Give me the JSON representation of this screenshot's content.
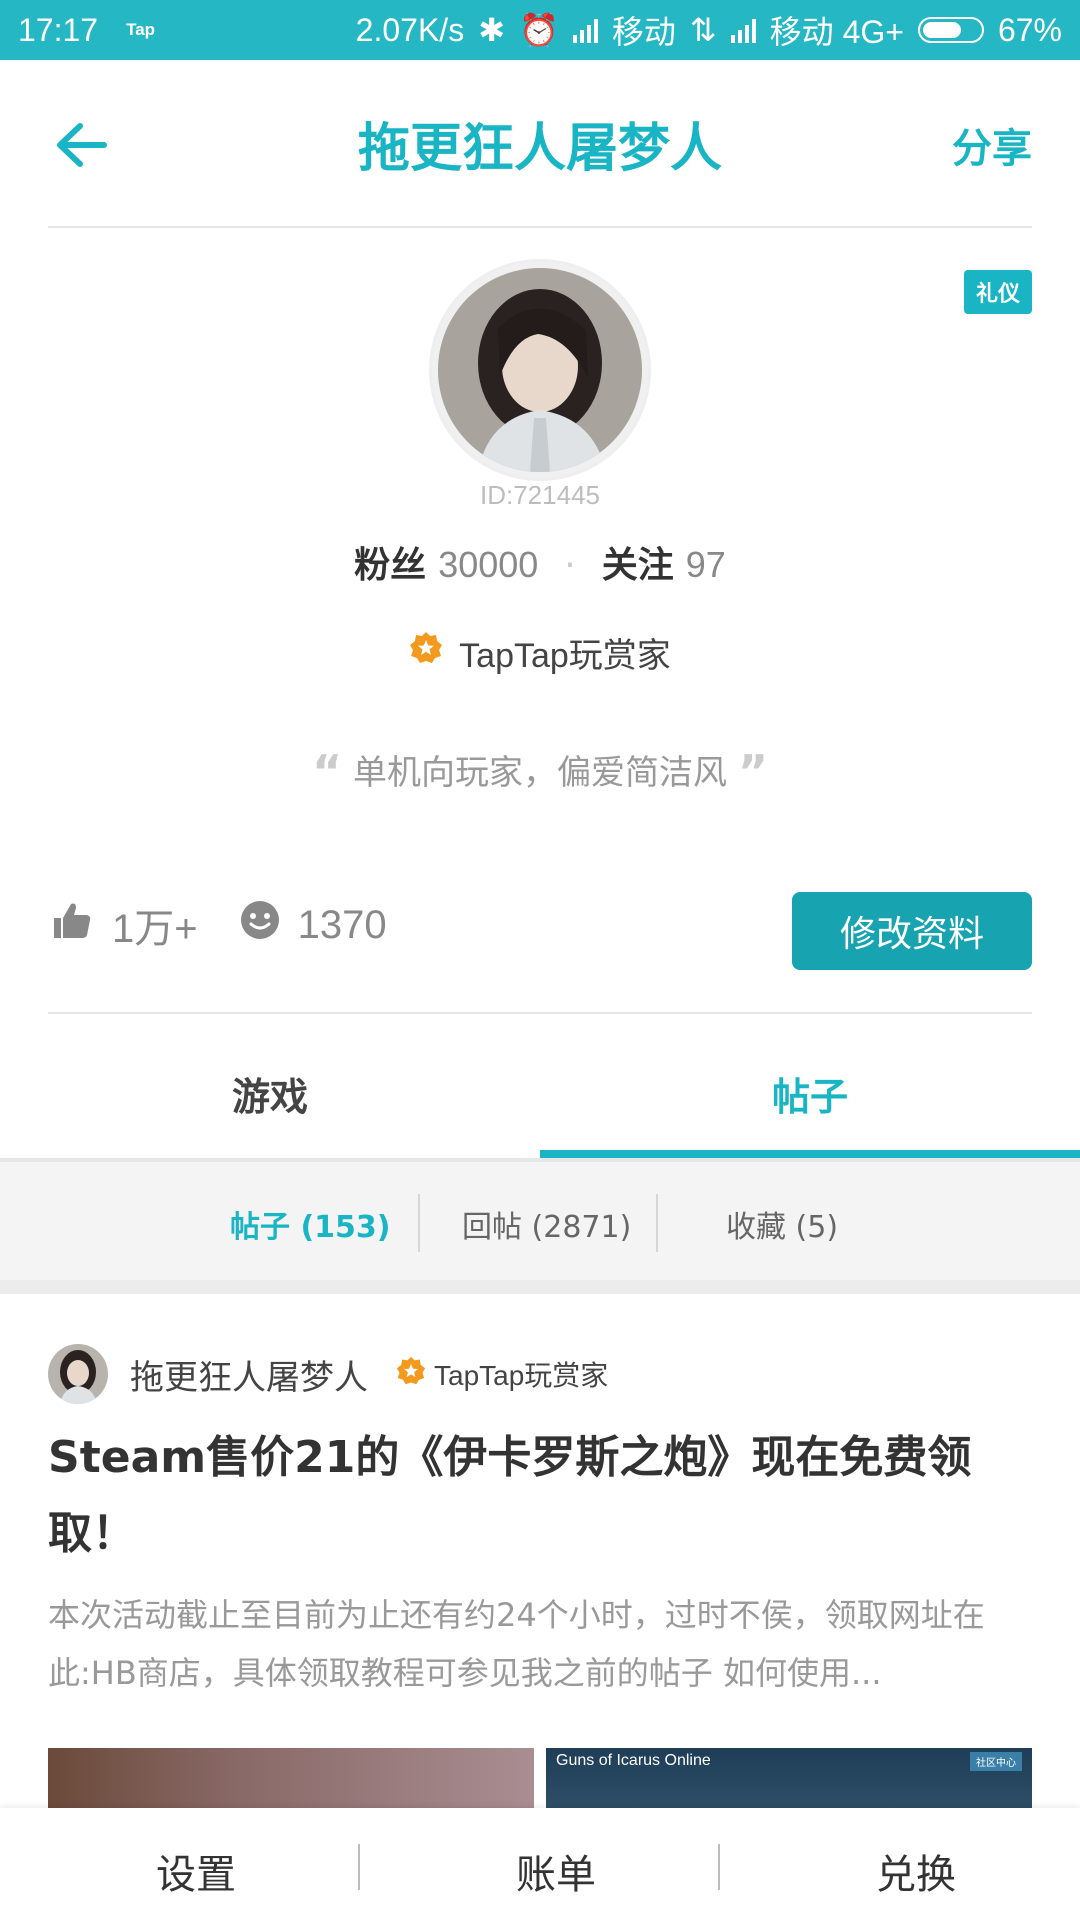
{
  "status_bar": {
    "time": "17:17",
    "app_badge": "Tap",
    "speed": "2.07K/s",
    "carrier1": "移动",
    "carrier2": "移动 4G+",
    "battery": "67%",
    "battery_level": 0.67
  },
  "header": {
    "title": "拖更狂人屠梦人",
    "share_label": "分享"
  },
  "profile": {
    "etiquette_tag": "礼仪",
    "user_id": "ID:721445",
    "fans_label": "粉丝",
    "fans_count": "30000",
    "follow_label": "关注",
    "follow_count": "97",
    "badge_label": "TapTap玩赏家",
    "bio": "单机向玩家，偏爱简洁风",
    "likes": "1万+",
    "smiles": "1370",
    "edit_button": "修改资料"
  },
  "tabs": [
    {
      "label": "游戏",
      "active": false
    },
    {
      "label": "帖子",
      "active": true
    }
  ],
  "subtabs": [
    {
      "label": "帖子 (153)",
      "active": true
    },
    {
      "label": "回帖 (2871)",
      "active": false
    },
    {
      "label": "收藏 (5)",
      "active": false
    }
  ],
  "post": {
    "author": "拖更狂人屠梦人",
    "author_badge": "TapTap玩赏家",
    "title": "Steam售价21的《伊卡罗斯之炮》现在免费领取！",
    "body": "本次活动截止至目前为止还有约24个小时，过时不侯，领取网址在此:HB商店，具体领取教程可参见我之前的帖子 如何使用...",
    "thumb2_title": "Guns of Icarus Online",
    "thumb2_tag": "社区中心"
  },
  "bottom_bar": {
    "settings": "设置",
    "bill": "账单",
    "exchange": "兑换"
  },
  "colors": {
    "accent": "#19b5c4",
    "status_bar": "#26b7c4",
    "badge_orange": "#f39a1e"
  }
}
